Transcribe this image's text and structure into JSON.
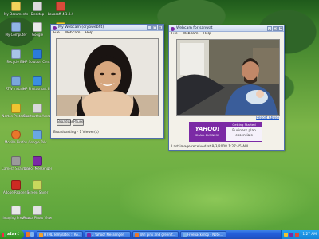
{
  "desktop_icons": [
    {
      "label": "My Documents",
      "color": "#f2d35a"
    },
    {
      "label": "Desktop",
      "color": "#dcdcdc"
    },
    {
      "label": "Lavasoft 4.1.0.4",
      "color": "#d94b3a"
    },
    {
      "label": "My Computer",
      "color": "#8fb4e6"
    },
    {
      "label": "Google",
      "color": "#eaeaea"
    },
    {
      "label": "Sprint PCS",
      "color": "#f6d72b"
    },
    {
      "label": "Recycle Bin",
      "color": "#a8c4e8"
    },
    {
      "label": "HP Solution Center",
      "color": "#2b7bd9"
    },
    {
      "label": "RTW Installer",
      "color": "#7aa7db"
    },
    {
      "label": "HP Photosmart Essential",
      "color": "#3a8fe0"
    },
    {
      "label": "Norton Protection",
      "color": "#f0c430"
    },
    {
      "label": "Shortcut to Amazon...",
      "color": "#d9d9d9"
    },
    {
      "label": "Mozilla Firefox",
      "color": "#e9762b"
    },
    {
      "label": "Google Talk",
      "color": "#69a7e4"
    },
    {
      "label": "Camera Snapshot",
      "color": "#9b9b9b"
    },
    {
      "label": "Yahoo! Messenger",
      "color": "#7b2aa5"
    },
    {
      "label": "Adobe Reader 8",
      "color": "#cc2a22"
    },
    {
      "label": "Screen Saver",
      "color": "#c8d85c"
    },
    {
      "label": "Imaging Preview",
      "color": "#e8e8e8"
    },
    {
      "label": "Picasa Photo Viewer",
      "color": "#e2e2e2"
    }
  ],
  "webcam_left": {
    "title": "My Webcam (cryowebfit)",
    "menu": [
      "File",
      "Webcam",
      "Help"
    ],
    "broadcast_label": "Broadcast",
    "pause_label": "Pause",
    "status": "Broadcasting - 1 Viewer(s)"
  },
  "webcam_right": {
    "title": "Webcam for sanwat",
    "menu": [
      "File",
      "Webcam",
      "Help"
    ],
    "report_link": "Report Abuse",
    "ad_brand": "YAHOO!",
    "ad_brand_sub": "SMALL BUSINESS",
    "ad_head": "Getting Started",
    "ad_text": "Business plan essentials",
    "status": "Last image received at 8/3/2008 1:27:45 AM"
  },
  "taskbar": {
    "start_label": "start",
    "tasks": [
      {
        "label": "HTML Templates :: Ko...",
        "color": "#f4a02a"
      },
      {
        "label": "3 Yahoo! Messenger",
        "color": "#7b2aa5"
      },
      {
        "label": "Wifi pink and green t...",
        "color": "#e9762b"
      },
      {
        "label": "Freebackdrop - Note...",
        "color": "#7ab0ea"
      }
    ],
    "clock": "1:27 AM"
  }
}
